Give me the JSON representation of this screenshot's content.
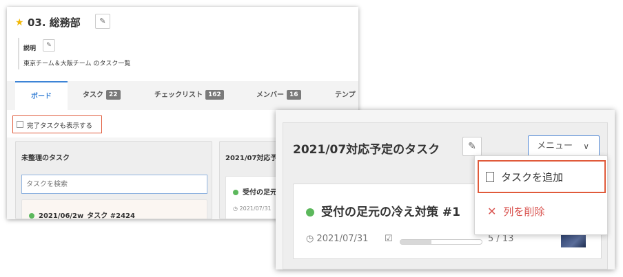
{
  "project": {
    "title": "03. 総務部",
    "description_label": "説明",
    "description": "東京チーム＆大阪チーム のタスク一覧"
  },
  "tabs": [
    {
      "label": "ボード",
      "count": ""
    },
    {
      "label": "タスク",
      "count": "22"
    },
    {
      "label": "チェックリスト",
      "count": "162"
    },
    {
      "label": "メンバー",
      "count": "16"
    },
    {
      "label": "テンプ",
      "count": ""
    }
  ],
  "filter": {
    "show_completed_label": "完了タスクも表示する"
  },
  "columns": [
    {
      "title": "未整理のタスク",
      "search_placeholder": "タスクを検索",
      "card_title": "2021/06/2w_タスク #2424"
    },
    {
      "title": "2021/07対応予",
      "card_title": "受付の足元",
      "card_date": "2021/07/31"
    }
  ],
  "list": {
    "title": "2021/07対応予定のタスク",
    "menu_label": "メニュー",
    "card": {
      "title": "受付の足元の冷え対策 #1",
      "date": "2021/07/31",
      "checklist": "5 / 13",
      "progress": 0.38
    }
  },
  "menu": {
    "add_task": "タスクを追加",
    "delete_column": "列を削除"
  },
  "colors": {
    "accent": "#3d84d6",
    "highlight": "#e05a3a",
    "status_green": "#5cb85c",
    "delete_red": "#d9534f"
  }
}
